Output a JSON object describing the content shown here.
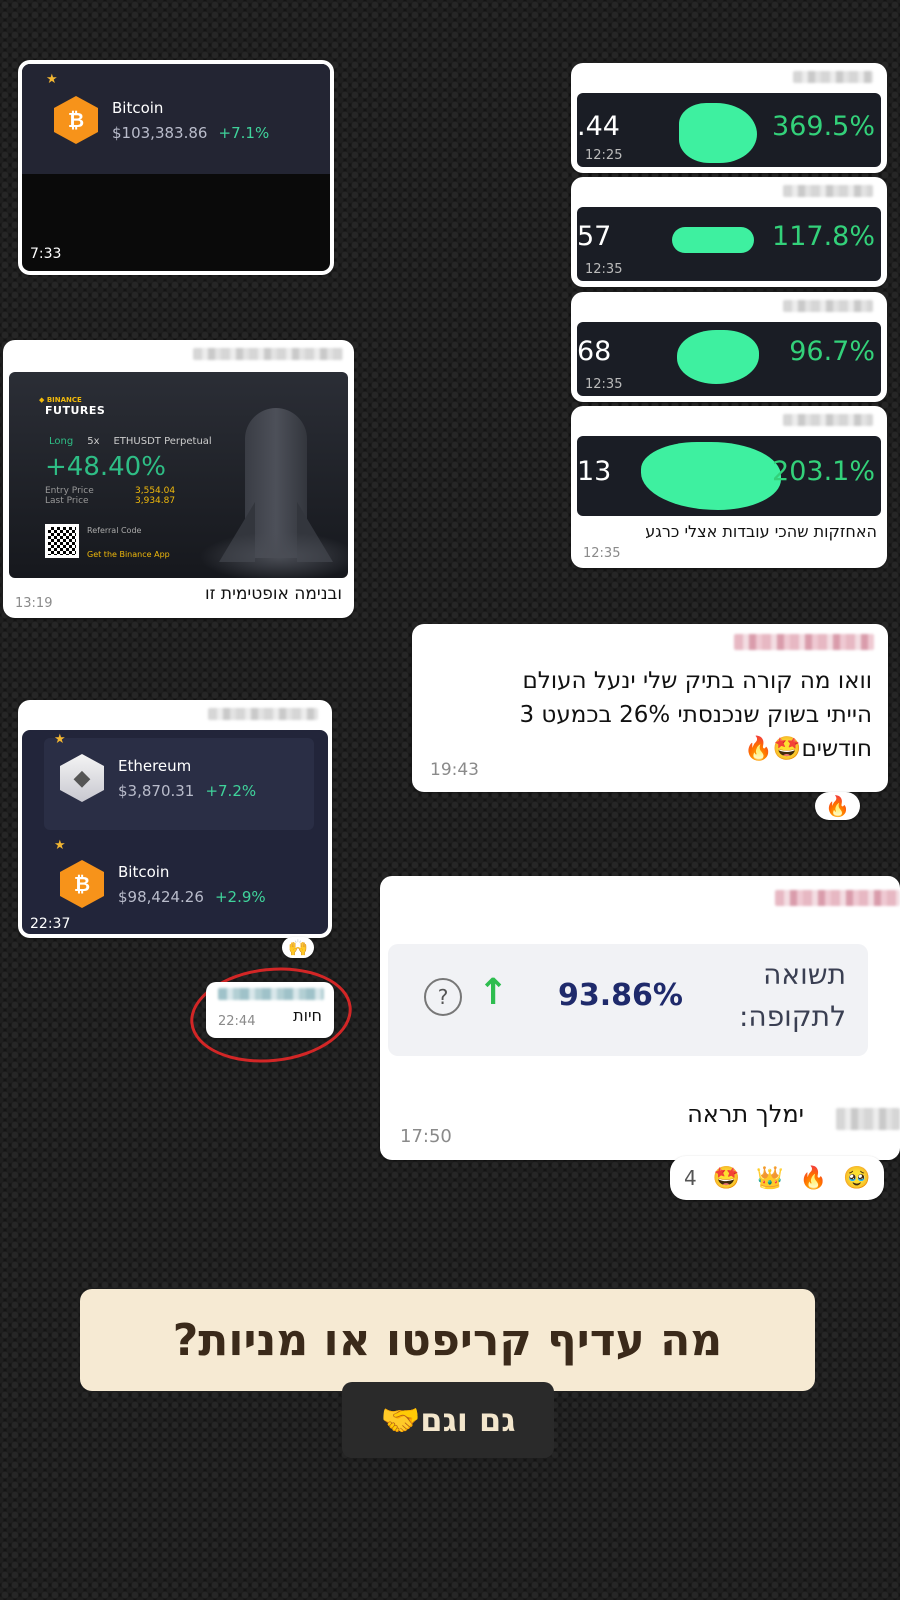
{
  "msg_bitcoin_1": {
    "coin": "Bitcoin",
    "price": "$103,383.86",
    "change": "+7.1%",
    "time": "7:33",
    "star": "★",
    "coin_symbol": "₿"
  },
  "msg_stocks": {
    "rows": [
      {
        "num": ".44",
        "pct": "369.5%",
        "time": "12:25"
      },
      {
        "num": "57",
        "pct": "117.8%",
        "time": "12:35"
      },
      {
        "num": "68",
        "pct": "96.7%",
        "time": "12:35"
      },
      {
        "num": "13",
        "pct": "203.1%",
        "time": "12:35"
      }
    ],
    "caption": "האחזקות שהכי עובדות אצלי כרגע",
    "time": "12:35"
  },
  "msg_binance": {
    "brand": "BINANCE",
    "product": "FUTURES",
    "side": "Long",
    "leverage": "5x",
    "pair": "ETHUSDT Perpetual",
    "roi": "+48.40%",
    "entry_label": "Entry Price",
    "entry_value": "3,554.04",
    "last_label": "Last Price",
    "last_value": "3,934.87",
    "referral_label": "Referral Code",
    "app_label": "Get the Binance App",
    "caption": "ובנימה אופטימית זו",
    "time": "13:19"
  },
  "msg_portfolio": {
    "text_line1": "וואו מה קורה בתיק שלי ינעל העולם",
    "text_line2": "הייתי בשוק שנכנסתי 26% בכמעט 3",
    "text_line3": "חודשים🤩🔥",
    "time": "19:43",
    "reaction": "🔥"
  },
  "msg_crypto_two": {
    "coin1": "Ethereum",
    "price1": "$3,870.31",
    "change1": "+7.2%",
    "coin2": "Bitcoin",
    "price2": "$98,424.26",
    "change2": "+2.9%",
    "time": "22:37",
    "reaction": "🙌",
    "eth_symbol": "◆",
    "btc_symbol": "₿"
  },
  "msg_small": {
    "text": "חיות",
    "time": "22:44"
  },
  "msg_return": {
    "label_line1": "תשואה",
    "label_line2": "לתקופה:",
    "value": "93.86%",
    "arrow": "↑",
    "help": "?",
    "caption": "ימלך תראה",
    "time": "17:50",
    "reactions": [
      "🥹",
      "🔥",
      "👑",
      "🤩"
    ],
    "reaction_count": "4"
  },
  "headline": {
    "question": "מה עדיף קריפטו או מניות?",
    "answer": "גם וגם🤝"
  },
  "colors": {
    "accent_green": "#33d17a",
    "coin_gold": "#f7931a",
    "binance_yellow": "#f0b90b",
    "navy_value": "#1f2a6b"
  }
}
